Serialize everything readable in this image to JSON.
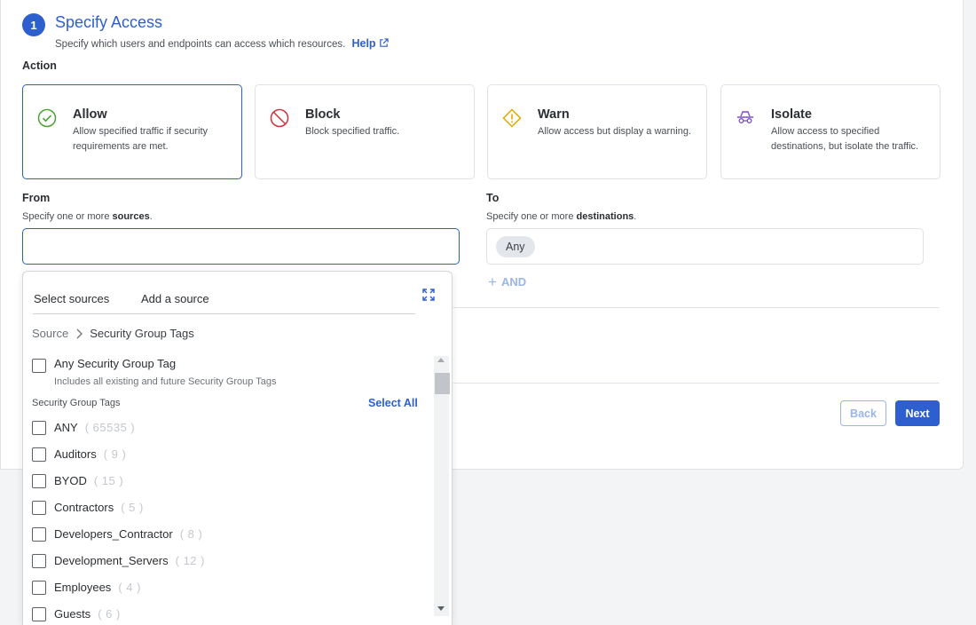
{
  "step": {
    "number": "1",
    "title": "Specify Access",
    "subtitle": "Specify which users and endpoints can access which resources.",
    "help_label": "Help"
  },
  "action": {
    "label": "Action",
    "cards": [
      {
        "title": "Allow",
        "desc": "Allow specified traffic if security requirements are met.",
        "icon": "check-circle-icon",
        "color": "#4aa232",
        "selected": true
      },
      {
        "title": "Block",
        "desc": "Block specified traffic.",
        "icon": "block-icon",
        "color": "#d0303a",
        "selected": false
      },
      {
        "title": "Warn",
        "desc": "Allow access but display a warning.",
        "icon": "warning-icon",
        "color": "#e0a800",
        "selected": false
      },
      {
        "title": "Isolate",
        "desc": "Allow access to specified destinations, but isolate the traffic.",
        "icon": "isolate-icon",
        "color": "#7b4fc6",
        "selected": false
      }
    ]
  },
  "from": {
    "label": "From",
    "sub_prefix": "Specify one or more ",
    "sub_bold": "sources",
    "sub_suffix": ".",
    "value": ""
  },
  "to": {
    "label": "To",
    "sub_prefix": "Specify one or more ",
    "sub_bold": "destinations",
    "sub_suffix": ".",
    "chip": "Any",
    "and_label": "AND"
  },
  "buttons": {
    "back": "Back",
    "next": "Next"
  },
  "dropdown": {
    "tabs": [
      "Select sources",
      "Add a source"
    ],
    "breadcrumb": [
      "Source",
      "Security Group Tags"
    ],
    "any_label": "Any Security Group Tag",
    "any_sub": "Includes all existing and future Security Group Tags",
    "section_label": "Security Group Tags",
    "select_all": "Select All",
    "items": [
      {
        "name": "ANY",
        "count": "( 65535 )"
      },
      {
        "name": "Auditors",
        "count": "( 9 )"
      },
      {
        "name": "BYOD",
        "count": "( 15 )"
      },
      {
        "name": "Contractors",
        "count": "( 5 )"
      },
      {
        "name": "Developers_Contractor",
        "count": "( 8 )"
      },
      {
        "name": "Development_Servers",
        "count": "( 12 )"
      },
      {
        "name": "Employees",
        "count": "( 4 )"
      },
      {
        "name": "Guests",
        "count": "( 6 )"
      }
    ]
  }
}
